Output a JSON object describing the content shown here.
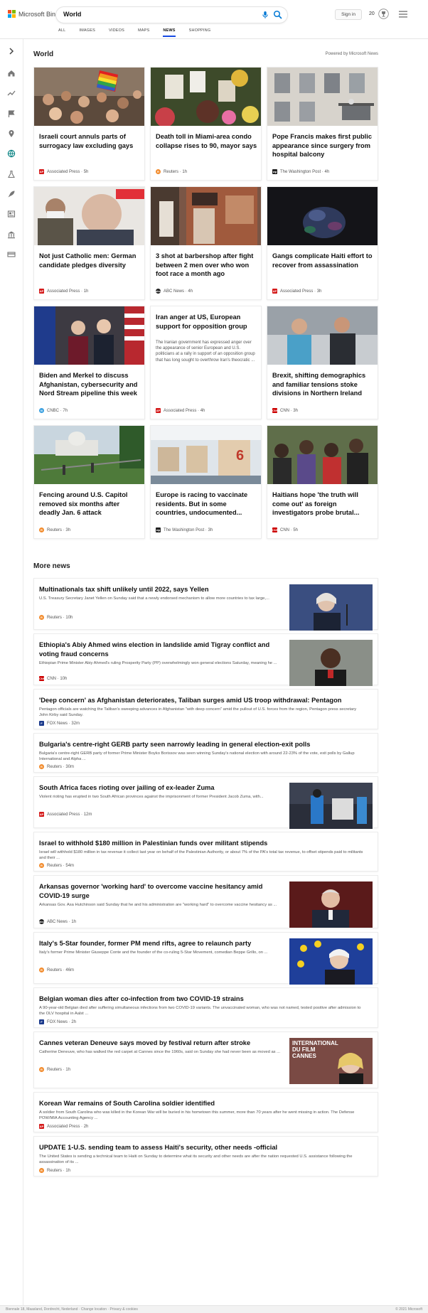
{
  "header": {
    "logo_text": "Microsoft Bing",
    "search_value": "World",
    "sign_in": "Sign in",
    "points": "20"
  },
  "tabs": [
    "ALL",
    "IMAGES",
    "VIDEOS",
    "MAPS",
    "NEWS",
    "SHOPPING"
  ],
  "active_tab": "NEWS",
  "world": {
    "title": "World",
    "powered_by": "Powered by Microsoft News",
    "cards": [
      {
        "title": "Israeli court annuls parts of surrogacy law excluding gays",
        "source": "Associated Press",
        "time": "5h",
        "logo": "AP"
      },
      {
        "title": "Death toll in Miami-area condo collapse rises to 90, mayor says",
        "source": "Reuters",
        "time": "1h",
        "logo": "R"
      },
      {
        "title": "Pope Francis makes first public appearance since surgery from hospital balcony",
        "source": "The Washington Post",
        "time": "4h",
        "logo": "wp"
      },
      {
        "title": "Not just Catholic men: German candidate pledges diversity",
        "source": "Associated Press",
        "time": "1h",
        "logo": "AP"
      },
      {
        "title": "3 shot at barbershop after fight between 2 men over who won foot race a month ago",
        "source": "ABC News",
        "time": "4h",
        "logo": "abc"
      },
      {
        "title": "Gangs complicate Haiti effort to recover from assassination",
        "source": "Associated Press",
        "time": "3h",
        "logo": "AP"
      },
      {
        "title": "Biden and Merkel to discuss Afghanistan, cybersecurity and Nord Stream pipeline this week",
        "source": "CNBC",
        "time": "7h",
        "logo": "N"
      },
      {
        "title": "Iran anger at US, European support for opposition group",
        "snippet": "The Iranian government has expressed anger over the appearance of senior European and U.S. politicians at a rally in support of an opposition group that has long sought to overthrow Iran's theocratic ...",
        "source": "Associated Press",
        "time": "4h",
        "logo": "AP"
      },
      {
        "title": "Brexit, shifting demographics and familiar tensions stoke divisions in Northern Ireland",
        "source": "CNN",
        "time": "3h",
        "logo": "CNN"
      },
      {
        "title": "Fencing around U.S. Capitol removed six months after deadly Jan. 6 attack",
        "source": "Reuters",
        "time": "3h",
        "logo": "R"
      },
      {
        "title": "Europe is racing to vaccinate residents. But in some countries, undocumented...",
        "source": "The Washington Post",
        "time": "3h",
        "logo": "wp"
      },
      {
        "title": "Haitians hope 'the truth will come out' as foreign investigators probe brutal...",
        "source": "CNN",
        "time": "5h",
        "logo": "CNN"
      }
    ]
  },
  "more_news": {
    "title": "More news",
    "items": [
      {
        "title": "Multinationals tax shift unlikely until 2022, says Yellen",
        "snippet": "U.S. Treasury Secretary Janet Yellen on Sunday said that a newly endorsed mechanism to allow more countries to tax large,...",
        "source": "Reuters",
        "time": "10h",
        "logo": "R"
      },
      {
        "title": "Ethiopia's Abiy Ahmed wins election in landslide amid Tigray conflict and voting fraud concerns",
        "snippet": "Ethiopian Prime Minister Abiy Ahmed's ruling Prosperity Party (PP) overwhelmingly won general elections Saturday, meaning he ...",
        "source": "CNN",
        "time": "10h",
        "logo": "CNN"
      },
      {
        "title": "'Deep concern' as Afghanistan deteriorates, Taliban surges amid US troop withdrawal: Pentagon",
        "snippet": "Pentagon officials are watching the Taliban's sweeping advances in Afghanistan \"with deep concern\" amid the pullout of U.S. forces from the region, Pentagon press secretary John Kirby said Sunday.",
        "source": "FOX News",
        "time": "32m",
        "logo": "F"
      },
      {
        "title": "Bulgaria's centre-right GERB party seen narrowly leading in general election-exit polls",
        "snippet": "Bulgaria's centre-right GERB party of former Prime Minister Boyko Borissov was seen winning Sunday's national election with around 22-23% of the vote, exit polls by Gallup International and Alpha ...",
        "source": "Reuters",
        "time": "30m",
        "logo": "R"
      },
      {
        "title": "South Africa faces rioting over jailing of ex-leader Zuma",
        "snippet": "Violent rioting has erupted in two South African provinces against the imprisonment of former President Jacob Zuma, with...",
        "source": "Associated Press",
        "time": "12m",
        "logo": "AP"
      },
      {
        "title": "Israel to withhold $180 million in Palestinian funds over militant stipends",
        "snippet": "Israel will withhold $180 million in tax revenue it collect last year on behalf of the Palestinian Authority, or about 7% of the PA's total tax revenue, to offset stipends paid to militants and their ...",
        "source": "Reuters",
        "time": "54m",
        "logo": "R"
      },
      {
        "title": "Arkansas governor 'working hard' to overcome vaccine hesitancy amid COVID-19 surge",
        "snippet": "Arkansas Gov. Asa Hutchinson said Sunday that he and his administration are \"working hard\" to overcome vaccine hesitancy as ...",
        "source": "ABC News",
        "time": "1h",
        "logo": "abc"
      },
      {
        "title": "Italy's 5-Star founder, former PM mend rifts, agree to relaunch party",
        "snippet": "Italy's former Prime Minister Giuseppe Conte and the founder of the co-ruling 5-Star Movement, comedian Beppe Grillo, on ...",
        "source": "Reuters",
        "time": "46m",
        "logo": "R"
      },
      {
        "title": "Belgian woman dies after co-infection from two COVID-19 strains",
        "snippet": "A 90-year-old Belgian died after suffering simultaneous infections from two COVID-19 variants.  The unvaccinated woman, who was not named, tested positive after admission to the OLV hospital in Aalst ...",
        "source": "FOX News",
        "time": "2h",
        "logo": "F"
      },
      {
        "title": "Cannes veteran Deneuve says moved by festival return after stroke",
        "snippet": "Catherine Deneuve, who has walked the red carpet at Cannes since the 1960s, said on Sunday she had never been as moved as ...",
        "source": "Reuters",
        "time": "1h",
        "logo": "R",
        "img_text": "INTERNATIONAL DU FILM CANNES"
      },
      {
        "title": "Korean War remains of South Carolina soldier identified",
        "snippet": "A soldier from South Carolina who was killed in the Korean War will be buried in his hometown this summer, more than 70 years after he went missing in action. The Defense POW/MIA Accounting Agency ...",
        "source": "Associated Press",
        "time": "2h",
        "logo": "AP"
      },
      {
        "title": "UPDATE 1-U.S. sending team to assess Haiti's security, other needs -official",
        "snippet": "The United States is sending a technical team to Haiti on Sunday to determine what its security and other needs are after the nation requested U.S. assistance following the assassination of its ...",
        "source": "Reuters",
        "time": "1h",
        "logo": "R"
      }
    ]
  },
  "footer": {
    "left": "Biennale 18, Maasland, Dordrecht, Nederland · Change location · Privacy & cookies",
    "right": "© 2021 Microsoft"
  },
  "colors": {
    "accent": "#174ae4",
    "bing_teal": "#0c8484",
    "ap_red": "#d41a1a",
    "reuters_orange": "#f28b2c",
    "cnn_red": "#cc0000",
    "fox_blue": "#1b3a8c"
  }
}
